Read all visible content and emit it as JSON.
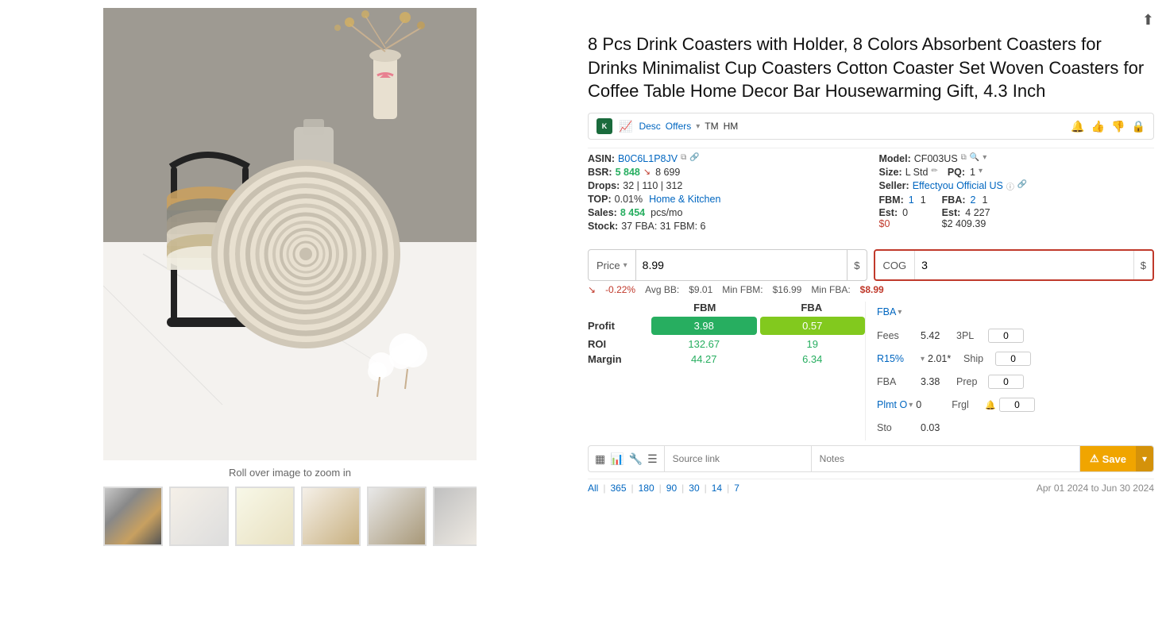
{
  "product": {
    "title": "8 Pcs Drink Coasters with Holder, 8 Colors Absorbent Coasters for Drinks Minimalist Cup Coasters Cotton Coaster Set Woven Coasters for Coffee Table Home Decor Bar Housewarming Gift, 4.3 Inch",
    "zoom_hint": "Roll over image to zoom in"
  },
  "keepa": {
    "logo": "K",
    "desc": "Desc",
    "offers_label": "Offers",
    "tm_label": "TM",
    "hm_label": "HM"
  },
  "asin": {
    "label": "ASIN:",
    "value": "B0C6L1P8JV"
  },
  "bsr": {
    "label": "BSR:",
    "value": "5 848",
    "arrow": "↘",
    "secondary": "8 699"
  },
  "drops": {
    "label": "Drops:",
    "value": "32 | 110 | 312"
  },
  "top": {
    "label": "TOP:",
    "value": "0.01%",
    "category": "Home & Kitchen"
  },
  "sales": {
    "label": "Sales:",
    "value": "8 454",
    "unit": "pcs/mo"
  },
  "stock": {
    "label": "Stock:",
    "value": "37 FBA: 31 FBM: 6"
  },
  "model": {
    "label": "Model:",
    "value": "CF003US"
  },
  "size": {
    "label": "Size:",
    "value": "L Std",
    "pq_label": "PQ:",
    "pq_value": "1"
  },
  "seller": {
    "label": "Seller:",
    "value": "Effectyou Official US"
  },
  "fbm": {
    "label": "FBM:",
    "val1": "1",
    "val2": "1"
  },
  "fba": {
    "label": "FBA:",
    "val1": "2",
    "val2": "1"
  },
  "est_fbm": {
    "label": "Est:",
    "val1": "0",
    "val2": "$0"
  },
  "est_fba": {
    "label": "Est:",
    "val1": "4 227",
    "val2": "$2 409.39"
  },
  "price": {
    "label": "Price",
    "value": "8.99",
    "currency": "$"
  },
  "cog": {
    "label": "COG",
    "value": "3",
    "currency": "$"
  },
  "bb": {
    "arrow": "↘",
    "pct": "-0.22%",
    "avg_label": "Avg BB:",
    "avg_value": "$9.01",
    "min_fbm_label": "Min FBM:",
    "min_fbm_value": "$16.99",
    "min_fba_label": "Min FBA:",
    "min_fba_value": "$8.99"
  },
  "calc": {
    "fbm_header": "FBM",
    "fba_header": "FBA",
    "profit_label": "Profit",
    "profit_fbm": "3.98",
    "profit_fba": "0.57",
    "roi_label": "ROI",
    "roi_fbm": "132.67",
    "roi_fba": "19",
    "margin_label": "Margin",
    "margin_fbm": "44.27",
    "margin_fba": "6.34"
  },
  "right_calc": {
    "fba_dropdown": "FBA",
    "fees_label": "Fees",
    "fees_value": "5.42",
    "tpl_label": "3PL",
    "tpl_value": "0",
    "r15_label": "R15%",
    "r15_value": "2.01*",
    "ship_label": "Ship",
    "ship_value": "0",
    "fba_label": "FBA",
    "fba_value": "3.38",
    "prep_label": "Prep",
    "prep_value": "0",
    "plmt_label": "Plmt O",
    "plmt_value": "0",
    "frgl_label": "Frgl",
    "frgl_value": "0",
    "sto_label": "Sto",
    "sto_value": "0.03"
  },
  "bottom_bar": {
    "source_link_placeholder": "Source link",
    "notes_placeholder": "Notes",
    "save_label": "Save"
  },
  "date_range": {
    "links": [
      "All",
      "365",
      "180",
      "90",
      "30",
      "14",
      "7"
    ],
    "separator": "|",
    "date_text": "Apr 01 2024 to Jun 30 2024"
  }
}
